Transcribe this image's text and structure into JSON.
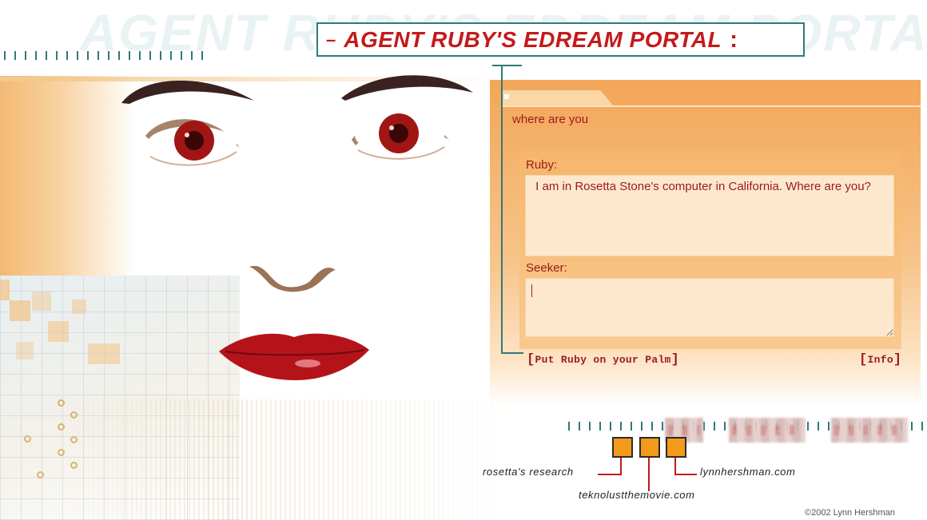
{
  "header": {
    "background_text": "AGENT RUBY'S EDREAM PORTA",
    "title_dash": "–",
    "title": "AGENT RUBY'S EDREAM PORTAL",
    "title_colon": ":"
  },
  "chat": {
    "last_question": "where are you",
    "ruby_label": "Ruby:",
    "ruby_response": "I am in Rosetta Stone's computer in California. Where are you?",
    "seeker_label": "Seeker:",
    "seeker_value": "",
    "palm_link": "Put Ruby on your Palm",
    "info_link": "Info"
  },
  "nav": {
    "links": [
      "rosetta's research",
      "teknolustthemovie.com",
      "lynnhershman.com"
    ]
  },
  "footer": {
    "copyright": "©2002 Lynn Hershman"
  },
  "colors": {
    "accent_red": "#c41a1a",
    "teal": "#2f7a7c",
    "panel_orange": "#f3a658",
    "nav_square": "#f39a1c"
  }
}
